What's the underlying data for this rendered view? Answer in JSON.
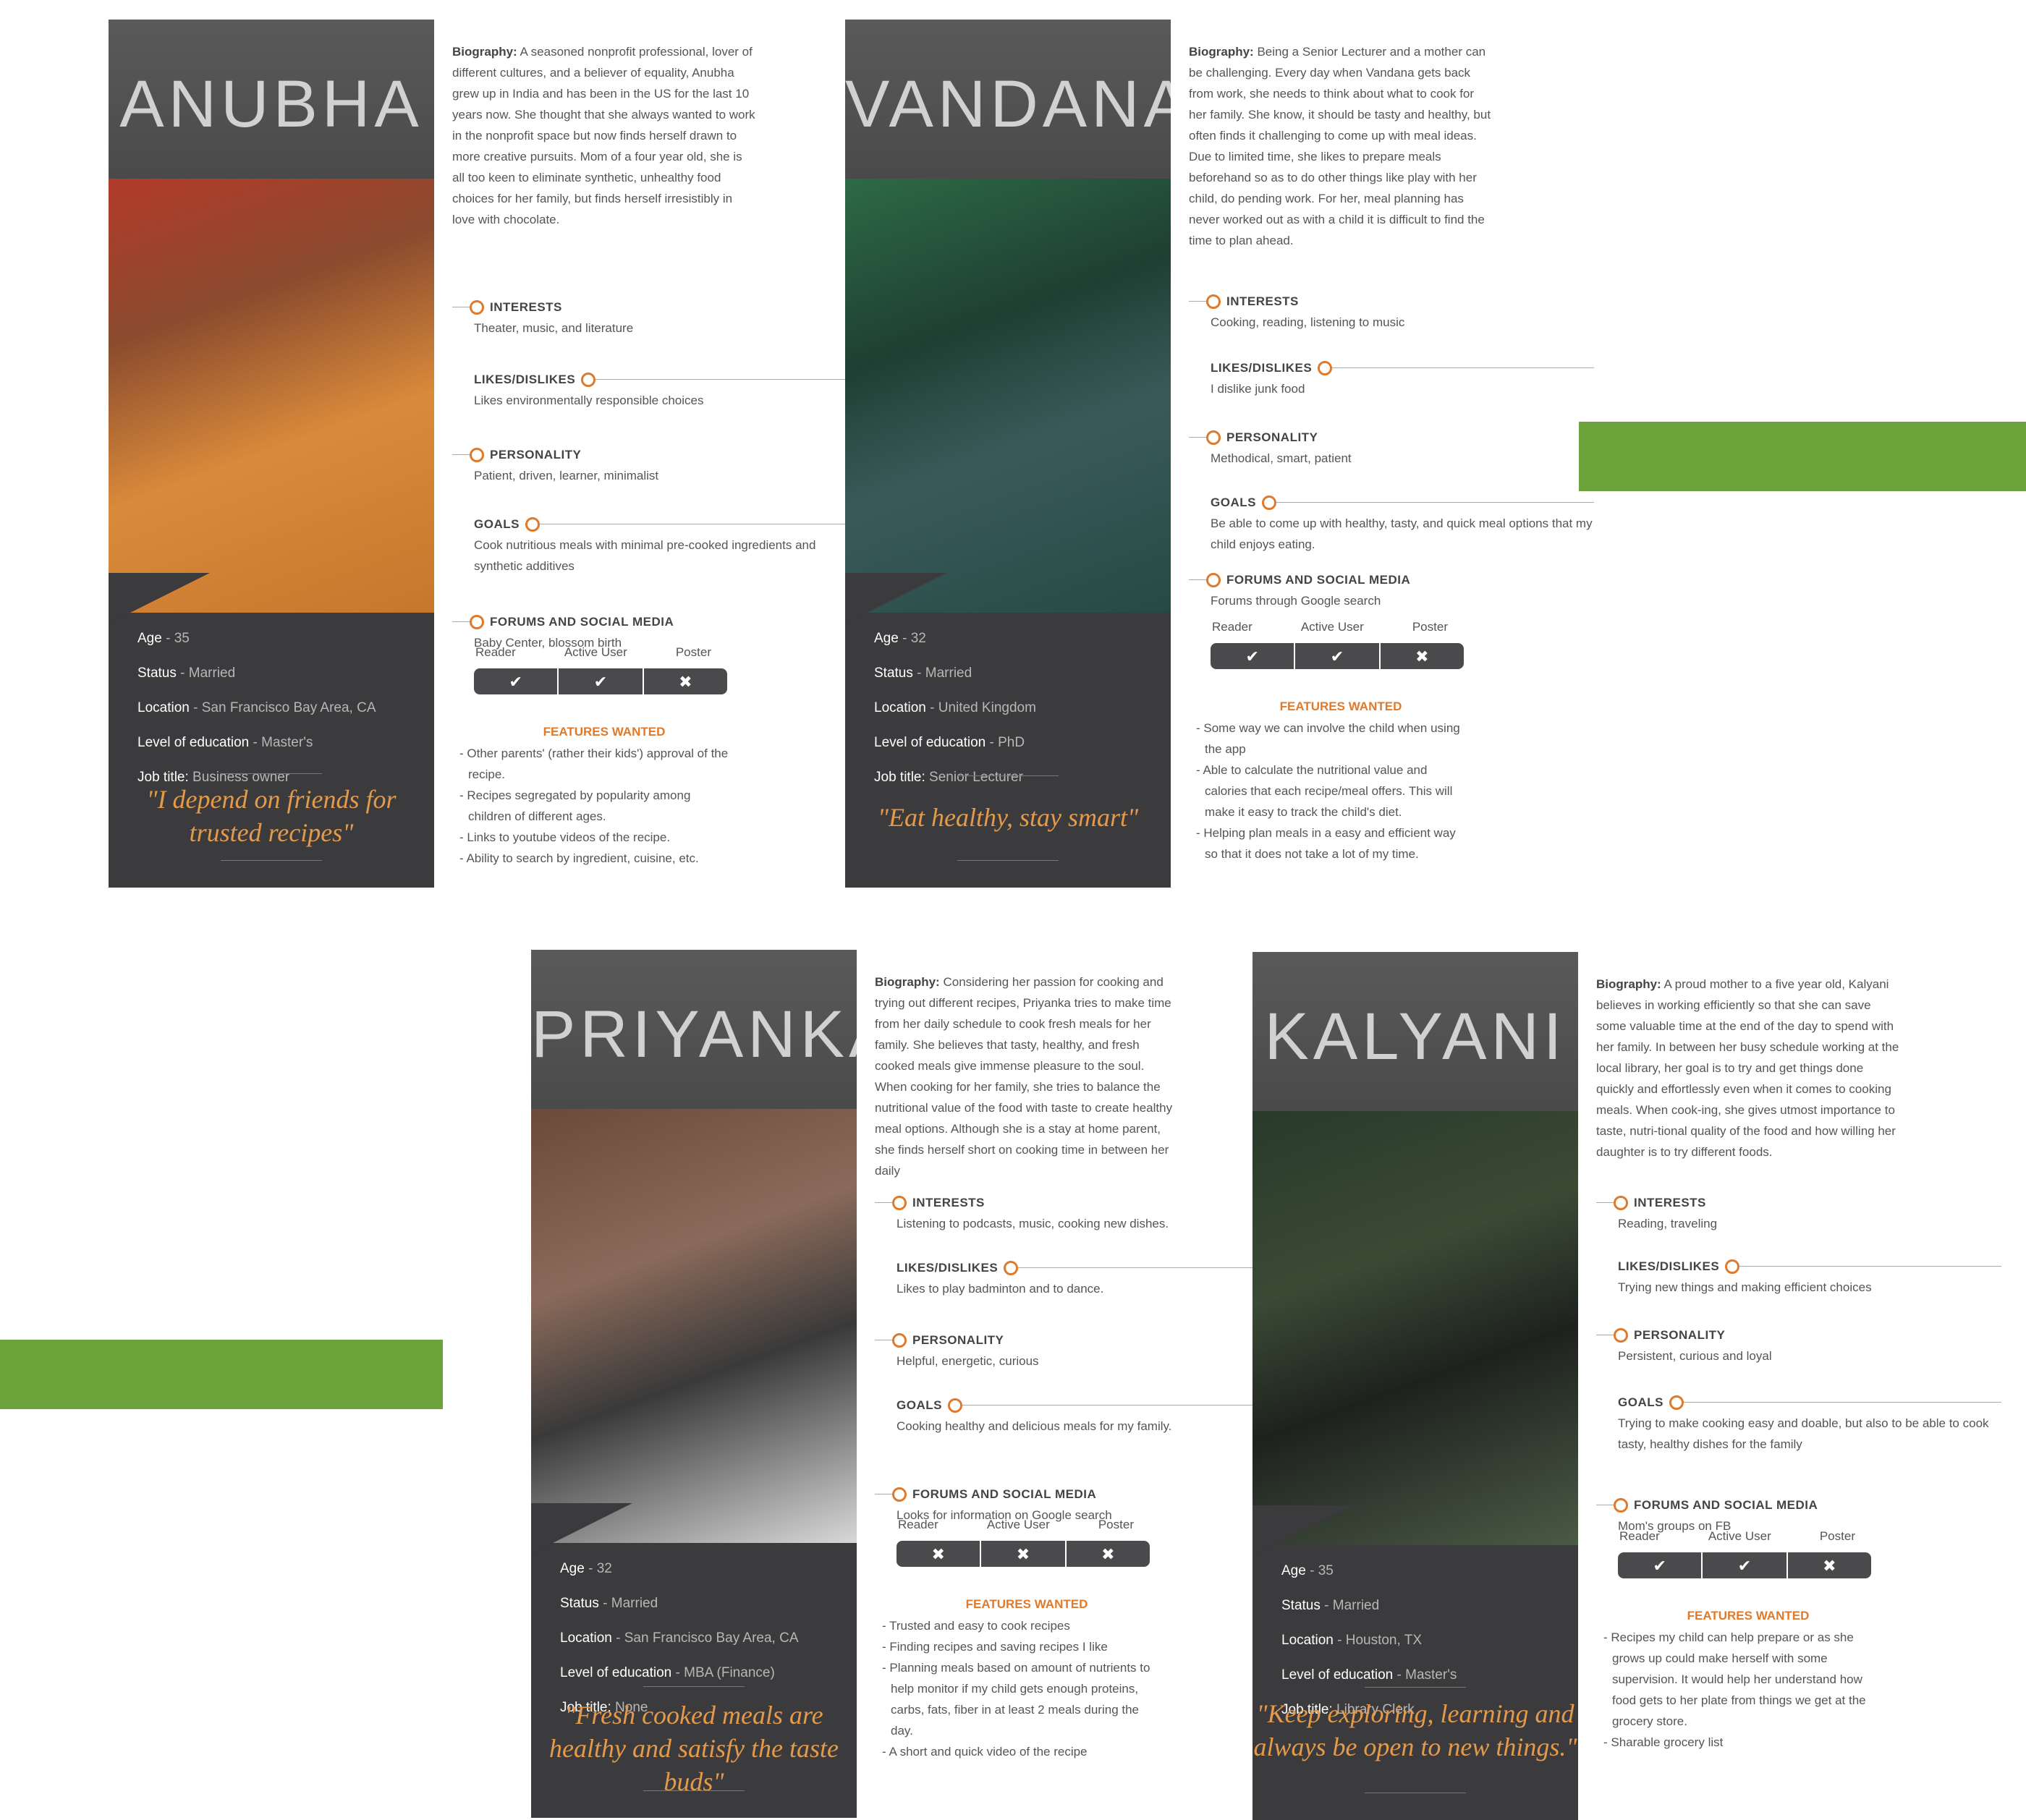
{
  "colors": {
    "accent": "#e07a2a",
    "green": "#6ba23a",
    "card": "#3b3b3d",
    "quote": "#e49a4a"
  },
  "labels": {
    "biography": "Biography:",
    "interests": "INTERESTS",
    "likes": "LIKES/DISLIKES",
    "personality": "PERSONALITY",
    "goals": "GOALS",
    "forums": "FORUMS AND SOCIAL MEDIA",
    "features": "FEATURES WANTED",
    "reader": "Reader",
    "active": "Active User",
    "poster": "Poster",
    "age": "Age",
    "status": "Status",
    "location": "Location",
    "education": "Level of education",
    "job": "Job title:"
  },
  "personas": [
    {
      "name": "ANUBHA",
      "age": "35",
      "status": "Married",
      "location": "San Francisco Bay Area, CA",
      "education": "Master's",
      "job": "Business owner",
      "quote": "\"I depend on friends for trusted recipes\"",
      "bio": "A seasoned nonprofit professional, lover of different cultures, and a believer of equality, Anubha grew up in India and has been in the US for the last 10 years now. She thought that she always wanted to work in the nonprofit space but now finds herself drawn to more creative pursuits. Mom of a four year old, she is all too keen to eliminate synthetic, unhealthy food choices for her family, but finds herself irresistibly in love with chocolate.",
      "interests": "Theater, music, and literature",
      "likes": "Likes environmentally responsible choices",
      "personality": "Patient, driven, learner, minimalist",
      "goals": "Cook nutritious meals with minimal pre-cooked ingredients and synthetic additives",
      "forums": "Baby Center, blossom birth",
      "usage": [
        "check",
        "check",
        "cross"
      ],
      "features": [
        "- Other parents' (rather their kids') approval of the recipe.",
        "- Recipes segregated by popularity among children of different ages.",
        "- Links to youtube videos of the recipe.",
        "- Ability to search by ingredient, cuisine, etc."
      ]
    },
    {
      "name": "VANDANA",
      "age": "32",
      "status": "Married",
      "location": "United Kingdom",
      "education": "PhD",
      "job": "Senior Lecturer",
      "quote": "\"Eat healthy, stay smart\"",
      "bio": "Being a Senior Lecturer and a mother can be challenging. Every day when Vandana gets back from work, she needs to think about what to cook for her family. She know, it should be tasty and healthy, but often finds it challenging to come up with meal ideas. Due to limited time, she likes to prepare meals beforehand so as to do other things like play with her child, do pending work. For her, meal planning has never worked out as with a child it is difficult to find the time to plan ahead.",
      "interests": "Cooking, reading, listening to music",
      "likes": "I dislike  junk food",
      "personality": "Methodical, smart, patient",
      "goals": "Be able to come up with healthy, tasty, and quick meal options that my child enjoys eating.",
      "forums": "Forums through Google search",
      "usage": [
        "check",
        "check",
        "cross"
      ],
      "features": [
        "- Some way we can involve the child when using the app",
        "- Able to calculate the nutritional value and calories that each recipe/meal offers. This will make it easy to track the child's diet.",
        "- Helping plan meals in a easy and efficient way so that it does not take a lot of my time."
      ]
    },
    {
      "name": "PRIYANKA",
      "age": "32",
      "status": "Married",
      "location": "San Francisco Bay Area, CA",
      "education": "MBA (Finance)",
      "job": "None",
      "quote": "\"Fresh cooked meals are healthy and satisfy the taste buds\"",
      "bio": "Considering her passion for cooking and trying out different recipes, Priyanka tries to make time from her daily schedule to cook fresh meals for her family. She believes that  tasty, healthy, and fresh cooked meals give immense pleasure to the soul. When cooking for her family, she tries to balance the nutritional value of the food with taste to create healthy meal options. Although she is a stay at home parent, she finds herself short on cooking time in between her daily",
      "interests": "Listening to podcasts, music, cooking new dishes.",
      "likes": "Likes to play badminton and to dance.",
      "personality": "Helpful, energetic, curious",
      "goals": "Cooking healthy and delicious meals for my family.",
      "forums": "Looks for information  on Google search",
      "usage": [
        "cross",
        "cross",
        "cross"
      ],
      "features": [
        "- Trusted and easy to cook recipes",
        "- Finding recipes and saving recipes I like",
        "- Planning meals based on amount of nutrients to help monitor if my child gets enough proteins, carbs, fats, fiber in at least 2 meals during the day.",
        "- A short and quick video of the recipe"
      ]
    },
    {
      "name": "KALYANI",
      "age": "35",
      "status": "Married",
      "location": "Houston, TX",
      "education": "Master's",
      "job": "Library Clerk",
      "quote": "\"Keep exploring, learning and always be open to new things.\"",
      "bio": "A proud mother to a five year old, Kalyani believes in working efficiently so that she can save some valuable time at the end of the day to spend with her family. In between her busy schedule working at the local library, her goal is to try and get things done quickly and effortlessly even when it comes to cooking meals. When cook-ing, she gives utmost importance to taste, nutri-tional quality of the food and how willing her daughter is to try different foods.",
      "interests": "Reading, traveling",
      "likes": "Trying new things and making efficient choices",
      "personality": "Persistent, curious and loyal",
      "goals": "Trying to make cooking easy and doable, but also to be able to cook tasty, healthy dishes for the family",
      "forums": "Mom's groups on FB",
      "usage": [
        "check",
        "check",
        "cross"
      ],
      "features": [
        "- Recipes my child can help prepare or as she grows up could make herself with some supervision. It would help her understand how food gets to her plate from things we get at the grocery store.",
        "- Sharable grocery list"
      ]
    }
  ]
}
